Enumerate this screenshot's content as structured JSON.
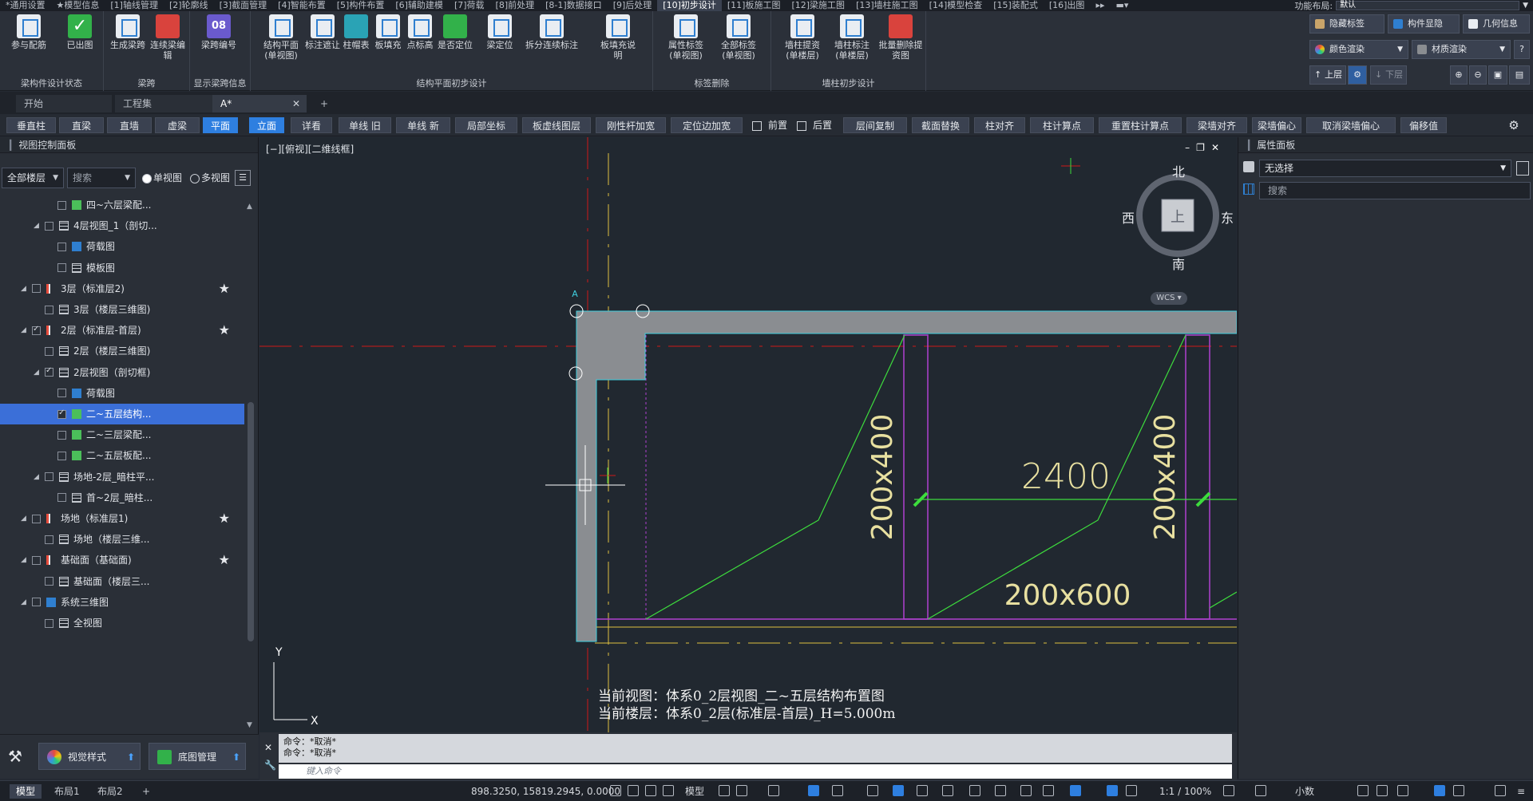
{
  "menubar": {
    "items": [
      "*通用设置",
      "★模型信息",
      "[1]轴线管理",
      "[2]轮廓线",
      "[3]截面管理",
      "[4]智能布置",
      "[5]构件布置",
      "[6]辅助建模",
      "[7]荷载",
      "[8]前处理",
      "[8-1]数据接口",
      "[9]后处理",
      "[10]初步设计",
      "[11]板施工图",
      "[12]梁施工图",
      "[13]墙柱施工图",
      "[14]模型检查",
      "[15]装配式",
      "[16]出图"
    ],
    "active_index": 12,
    "layout_label": "功能布局:",
    "layout_value": "默认"
  },
  "ribbon": {
    "groups": [
      {
        "title": "梁构件设计状态",
        "buttons": [
          "参与配筋",
          "已出图"
        ]
      },
      {
        "title": "梁跨",
        "buttons": [
          "生成梁跨",
          "连续梁编辑"
        ]
      },
      {
        "title": "显示梁跨信息",
        "buttons": [
          "梁跨编号"
        ]
      },
      {
        "title": "结构平面初步设计",
        "buttons": [
          "结构平面(单视图)",
          "标注遮让",
          "柱帽表",
          "板填充",
          "点标高",
          "是否定位",
          "梁定位",
          "拆分连续标注",
          "板填充说明"
        ]
      },
      {
        "title": "标签删除",
        "buttons": [
          "属性标签(单视图)",
          "全部标签(单视图)"
        ]
      },
      {
        "title": "墙柱初步设计",
        "buttons": [
          "墙柱提资(单楼层)",
          "墙柱标注(单楼层)",
          "批量删除提资图"
        ]
      }
    ],
    "badge_08": "08",
    "side": {
      "hide_tags": "隐藏标签",
      "component_show": "构件显隐",
      "geometry": "几何信息",
      "color_render": "颜色渲染",
      "material_render": "材质渲染",
      "upper_floor": "上层",
      "lower_floor": "下层"
    }
  },
  "tabs": {
    "items": [
      "开始",
      "工程集",
      "A*"
    ],
    "add": "+"
  },
  "commands": [
    "垂直柱",
    "直梁",
    "直墙",
    "虚梁",
    "平面",
    "立面",
    "详看",
    "单线 旧",
    "单线 新",
    "局部坐标",
    "板虚线图层",
    "刚性杆加宽",
    "定位边加宽",
    "前置",
    "后置",
    "层间复制",
    "截面替换",
    "柱对齐",
    "柱计算点",
    "重置柱计算点",
    "梁墙对齐",
    "梁墙偏心",
    "取消梁墙偏心",
    "偏移值"
  ],
  "commands_active": [
    "平面",
    "立面"
  ],
  "left_panel": {
    "title": "视图控制面板",
    "floor_filter": "全部楼层",
    "search_placeholder": "搜索",
    "single_view": "单视图",
    "multi_view": "多视图",
    "tree": [
      {
        "label": "四~六层梁配...",
        "indent": 3,
        "icon": "green",
        "checked": false
      },
      {
        "label": "4层视图_1（剖切...",
        "indent": 2,
        "icon": "grid",
        "checked": false,
        "expanded": true
      },
      {
        "label": "荷载图",
        "indent": 3,
        "icon": "blue",
        "checked": false
      },
      {
        "label": "模板图",
        "indent": 3,
        "icon": "grid",
        "checked": false
      },
      {
        "label": "3层（标准层2)",
        "indent": 1,
        "icon": "bar",
        "checked": false,
        "star": true,
        "expanded": true
      },
      {
        "label": "3层（楼层三维图)",
        "indent": 2,
        "icon": "grid",
        "checked": false
      },
      {
        "label": "2层（标准层-首层)",
        "indent": 1,
        "icon": "bar",
        "checked": true,
        "star": true,
        "expanded": true
      },
      {
        "label": "2层（楼层三维图)",
        "indent": 2,
        "icon": "grid",
        "checked": false
      },
      {
        "label": "2层视图（剖切框)",
        "indent": 2,
        "icon": "grid",
        "checked": true,
        "expanded": true
      },
      {
        "label": "荷载图",
        "indent": 3,
        "icon": "blue",
        "checked": false
      },
      {
        "label": "二~五层结构...",
        "indent": 3,
        "icon": "green",
        "checked": true,
        "selected": true
      },
      {
        "label": "二~三层梁配...",
        "indent": 3,
        "icon": "green",
        "checked": false
      },
      {
        "label": "二~五层板配...",
        "indent": 3,
        "icon": "green",
        "checked": false
      },
      {
        "label": "场地-2层_暗柱平...",
        "indent": 2,
        "icon": "grid",
        "checked": false,
        "expanded": true
      },
      {
        "label": "首~2层_暗柱...",
        "indent": 3,
        "icon": "grid",
        "checked": false
      },
      {
        "label": "场地（标准层1)",
        "indent": 1,
        "icon": "bar",
        "checked": false,
        "star": true,
        "expanded": true
      },
      {
        "label": "场地（楼层三维...",
        "indent": 2,
        "icon": "grid",
        "checked": false
      },
      {
        "label": "基础面（基础面)",
        "indent": 1,
        "icon": "bar",
        "checked": false,
        "star": true,
        "expanded": true
      },
      {
        "label": "基础面（楼层三...",
        "indent": 2,
        "icon": "grid",
        "checked": false
      },
      {
        "label": "系统三维图",
        "indent": 1,
        "icon": "blue",
        "checked": false,
        "expanded": true
      },
      {
        "label": "全视图",
        "indent": 2,
        "icon": "grid",
        "checked": false
      }
    ],
    "bottom": {
      "visual_style": "视觉样式",
      "base_map": "底图管理"
    }
  },
  "canvas": {
    "view_label": "[−][俯视][二维线框]",
    "compass": {
      "north": "北",
      "south": "南",
      "east": "东",
      "west": "西",
      "top": "上"
    },
    "wcs": "WCS",
    "dim_2400": "2400",
    "dim_beam_1": "200x400",
    "dim_beam_2": "200x400",
    "dim_beam_3": "200x600",
    "axis_y": "Y",
    "axis_x": "X",
    "axis_a": "A",
    "current_view": "当前视图：体系0_2层视图_二~五层结构布置图",
    "current_floor": "当前楼层：体系0_2层(标准层-首层)_H=5.000m"
  },
  "right_panel": {
    "title": "属性面板",
    "selection": "无选择",
    "search_placeholder": "搜索"
  },
  "command_line": {
    "history": [
      "命令：*取消*",
      "命令：*取消*"
    ],
    "input_placeholder": "键入命令"
  },
  "status_bar": {
    "layout_tabs": [
      "模型",
      "布局1",
      "布局2"
    ],
    "add_tab": "+",
    "coordinates": "898.3250, 15819.2945, 0.0000",
    "model_label": "模型",
    "scale": "1:1 / 100%",
    "units": "小数"
  },
  "colors": {
    "accent": "#2e7fe0",
    "canvas_bg": "#212830",
    "wall_fill": "#8a8d91",
    "beam_green": "#3ddc3d",
    "column_purple": "#b040d0",
    "axis_red": "#d01818",
    "axis_yellow": "#e0c040",
    "dim_text": "#e8e0a0",
    "outline_cyan": "#40d0e0"
  }
}
